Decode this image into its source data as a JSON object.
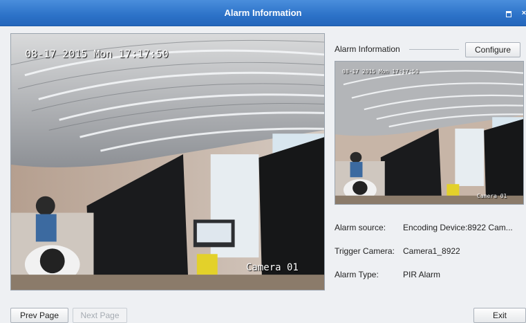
{
  "window": {
    "title": "Alarm Information",
    "close_glyph": "×"
  },
  "main_video": {
    "osd_time": "08-17 2015 Mon 17:17:50",
    "osd_camera": "Camera 01"
  },
  "side_panel": {
    "heading": "Alarm Information",
    "configure_label": "Configure",
    "thumb_osd_time": "08-17 2015 Mon 17:17:50",
    "thumb_osd_camera": "Camera 01",
    "details": [
      {
        "label": "Alarm source:",
        "value": "Encoding Device:8922 Cam..."
      },
      {
        "label": "Trigger Camera:",
        "value": "Camera1_8922"
      },
      {
        "label": "Alarm Type:",
        "value": "PIR Alarm"
      }
    ]
  },
  "footer": {
    "prev_label": "Prev Page",
    "next_label": "Next Page",
    "exit_label": "Exit"
  },
  "colors": {
    "titlebar": "#2c72c8",
    "background": "#eef0f3"
  }
}
